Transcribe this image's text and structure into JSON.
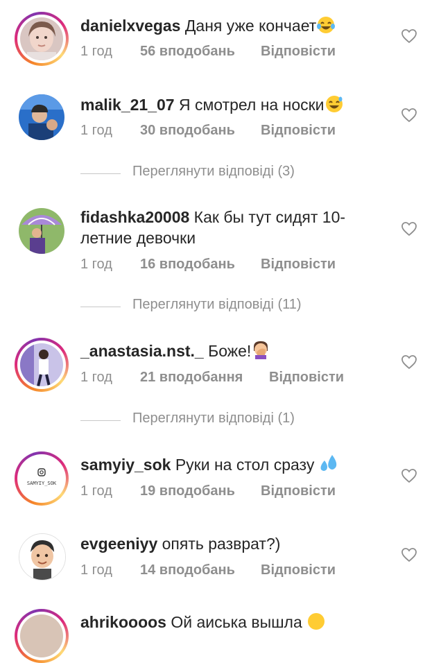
{
  "comments": [
    {
      "username": "danielxvegas",
      "text": " Даня уже кончает",
      "emoji": "laughing-tears-emoji",
      "time": "1 год",
      "likes": "56 вподобань",
      "reply": "Відповісти",
      "avatar": "girl-selfie-avatar"
    },
    {
      "username": "malik_21_07",
      "text": " Я смотрел на носки",
      "emoji": "sweat-smile-emoji",
      "time": "1 год",
      "likes": "30 вподобань",
      "reply": "Відповісти",
      "avatar": "boy-blue-avatar"
    },
    {
      "username": "fidashka20008",
      "text": " Как бы тут сидят 10-летние девочки",
      "emoji": "",
      "time": "1 год",
      "likes": "16 вподобань",
      "reply": "Відповісти",
      "avatar": "umbrella-avatar"
    },
    {
      "username": "_anastasia.nst._",
      "text": " Боже!",
      "emoji": "facepalm-emoji",
      "time": "1 год",
      "likes": "21 вподобання",
      "reply": "Відповісти",
      "avatar": "girl-pose-avatar"
    },
    {
      "username": "samyiy_sok",
      "text": " Руки на стол сразу ",
      "emoji": "sweat-droplets-emoji",
      "time": "1 год",
      "likes": "19 вподобань",
      "reply": "Відповісти",
      "avatar": "samyiy-sok-logo-avatar",
      "avatar_label": "SAMYIY_SOK"
    },
    {
      "username": "evgeeniyy",
      "text": " опять разврат?)",
      "emoji": "",
      "time": "1 год",
      "likes": "14 вподобань",
      "reply": "Відповісти",
      "avatar": "memoji-avatar"
    },
    {
      "username": "ahrikoooos",
      "text": " Ой аиська вышла",
      "emoji": "grin-emoji",
      "time": "",
      "likes": "",
      "reply": "",
      "avatar": "partial-avatar"
    }
  ],
  "view_replies": [
    "Переглянути відповіді (3)",
    "Переглянути відповіді (11)",
    "Переглянути відповіді (1)"
  ],
  "colors": {
    "text": "#262626",
    "meta": "#8e8e8e",
    "divider": "#c7c7c7",
    "ring_start": "#f58529",
    "ring_mid": "#dd2a7b",
    "ring_end": "#8134af"
  }
}
